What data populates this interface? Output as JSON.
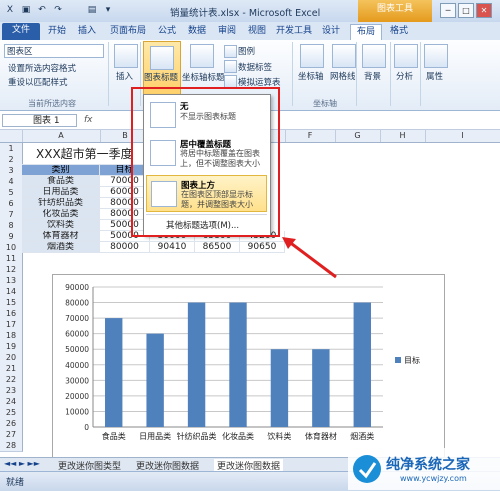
{
  "window": {
    "title": "销量统计表.xlsx - Microsoft Excel",
    "chart_tools_label": "图表工具",
    "min": "─",
    "max": "□",
    "close": "✕"
  },
  "menu": {
    "file": "文件",
    "tabs": [
      "开始",
      "插入",
      "页面布局",
      "公式",
      "数据",
      "审阅",
      "视图",
      "开发工具",
      "设计",
      "布局",
      "格式"
    ]
  },
  "ribbon": {
    "chart_area": "图表区",
    "format_selection": "设置所选内容格式",
    "reset_style": "重设以匹配样式",
    "current_selection_group": "当前所选内容",
    "insert": "插入",
    "chart_title": "图表标题",
    "axis_titles": "坐标轴标题",
    "legend": "图例",
    "data_labels": "数据标签",
    "analog_table": "模拟运算表",
    "axes": "坐标轴",
    "gridlines": "网格线",
    "axes_group": "坐标轴",
    "background": "背景",
    "analysis": "分析",
    "properties": "属性"
  },
  "formula_bar": {
    "name_box": "图表 1",
    "fx": "fx"
  },
  "sheet": {
    "columns": [
      "A",
      "B",
      "C",
      "D",
      "E",
      "F",
      "G",
      "H",
      "I"
    ],
    "rows": [
      "1",
      "2",
      "3",
      "4",
      "5",
      "6",
      "7",
      "8",
      "9",
      "10",
      "11",
      "12",
      "13",
      "14",
      "15",
      "16",
      "17",
      "18",
      "19",
      "20",
      "21",
      "22",
      "23",
      "24",
      "25",
      "26",
      "27",
      "28"
    ],
    "title": "XXX超市第一季度",
    "header": [
      "类别",
      "目标"
    ],
    "data": [
      [
        "食品类",
        "70000"
      ],
      [
        "日用品类",
        "60000"
      ],
      [
        "针纺织品类",
        "80000"
      ],
      [
        "化妆品类",
        "80000"
      ],
      [
        "饮料类",
        "50000"
      ],
      [
        "体育器材",
        "50000",
        "30000",
        "65800",
        "45200"
      ],
      [
        "烟酒类",
        "80000",
        "90410",
        "86500",
        "90650"
      ]
    ]
  },
  "dropdown": {
    "items": [
      {
        "title": "无",
        "desc": [
          "不显示图表标题"
        ]
      },
      {
        "title": "居中覆盖标题",
        "desc": [
          "将居中标题覆盖在图表",
          "上，但不调整图表大小"
        ]
      },
      {
        "title": "图表上方",
        "desc": [
          "在图表区顶部显示标",
          "题，并调整图表大小"
        ]
      }
    ],
    "more": "其他标题选项(M)..."
  },
  "chart_data": {
    "type": "bar",
    "categories": [
      "食品类",
      "日用品类",
      "针纺织品类",
      "化妆品类",
      "饮料类",
      "体育器材",
      "烟酒类"
    ],
    "series": [
      {
        "name": "目标",
        "values": [
          70000,
          60000,
          80000,
          80000,
          50000,
          50000,
          80000
        ]
      }
    ],
    "ylim": [
      0,
      90000
    ],
    "yticks": [
      "0",
      "10000",
      "20000",
      "30000",
      "40000",
      "50000",
      "60000",
      "70000",
      "80000",
      "90000"
    ],
    "grid": true,
    "legend": "right",
    "bar_color": "#4f81bd"
  },
  "sheet_tabs": [
    "更改迷你图类型",
    "更改迷你图数据",
    "更改迷你图数据"
  ],
  "status": "就绪",
  "watermark": {
    "brand": "纯净系统之家",
    "url": "www.ycwjzy.com"
  }
}
